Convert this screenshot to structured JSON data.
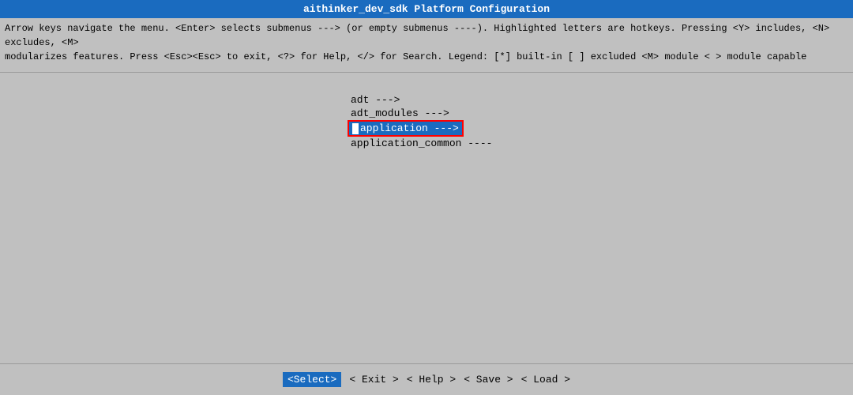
{
  "title": "aithinker_dev_sdk Platform Configuration",
  "info_line1": "Arrow keys navigate the menu.  <Enter> selects submenus ---> (or empty submenus ----).  Highlighted letters are hotkeys.  Pressing <Y> includes, <N> excludes, <M>",
  "info_line2": "modularizes features.  Press <Esc><Esc> to exit, <?> for Help, </> for Search.  Legend: [*] built-in  [ ] excluded  <M> module  < > module capable",
  "menu_items": [
    {
      "label": "adt  --->",
      "selected": false
    },
    {
      "label": "adt_modules  --->",
      "selected": false
    },
    {
      "label": "application  --->",
      "selected": true
    },
    {
      "label": "application_common  ----",
      "selected": false
    }
  ],
  "bottom_buttons": [
    {
      "label": "<Select>",
      "active": true
    },
    {
      "label": "< Exit >",
      "active": false
    },
    {
      "label": "< Help >",
      "active": false
    },
    {
      "label": "< Save >",
      "active": false
    },
    {
      "label": "< Load >",
      "active": false
    }
  ],
  "pressing_text": "Pressing"
}
